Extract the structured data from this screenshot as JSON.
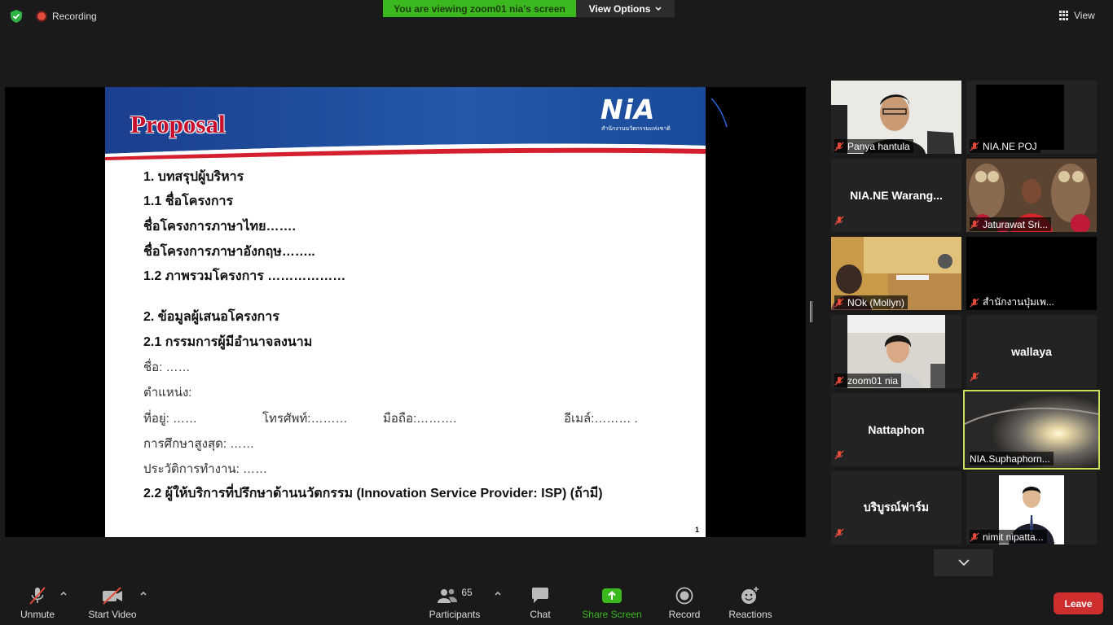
{
  "topbar": {
    "recording_label": "Recording",
    "viewing_banner": "You are viewing zoom01 nia's screen",
    "view_options_label": "View Options",
    "view_label": "View"
  },
  "slide": {
    "title": "Proposal",
    "logo_text": "NiA",
    "logo_subtext": "สำนักงานนวัตกรรมแห่งชาติ",
    "page_number": "1",
    "lines": {
      "l1": "1. บทสรุปผู้บริหาร",
      "l2": "1.1 ชื่อโครงการ",
      "l3": "ชื่อโครงการภาษาไทย…….",
      "l4": "ชื่อโครงการภาษาอังกฤษ……..",
      "l5": "1.2 ภาพรวมโครงการ ………………",
      "l6": "2. ข้อมูลผู้เสนอโครงการ",
      "l7": "2.1 กรรมการผู้มีอำนาจลงนาม",
      "l8": "ชื่อ: ……",
      "l9": "ตำแหน่ง:",
      "l10a": "ที่อยู่: ……",
      "l10b": "โทรศัพท์:………",
      "l10c": "มือถือ:……….",
      "l10d": "อีเมล์:……… .",
      "l11": "การศึกษาสูงสุด: ……",
      "l12": "ประวัติการทำงาน:  ……",
      "l13": "2.2 ผู้ให้บริการที่ปรึกษาด้านนวัตกรรม (Innovation Service Provider: ISP) (ถ้ามี)"
    }
  },
  "participants": [
    {
      "name": "Panya hantula"
    },
    {
      "name": "NIA.NE POJ"
    },
    {
      "name": "NIA.NE  Warang..."
    },
    {
      "name": "Jaturawat Sri..."
    },
    {
      "name": "NOk (Mollyn)"
    },
    {
      "name": "สำนักงานปุ่มเพ..."
    },
    {
      "name": "zoom01 nia"
    },
    {
      "name": "wallaya"
    },
    {
      "name": "Nattaphon"
    },
    {
      "name": "NIA.Suphaphorn..."
    },
    {
      "name": "บริบูรณ์ฟาร์ม"
    },
    {
      "name": "nimit nipatta..."
    }
  ],
  "toolbar": {
    "unmute": "Unmute",
    "start_video": "Start Video",
    "participants": "Participants",
    "participants_count": "65",
    "chat": "Chat",
    "share_screen": "Share Screen",
    "record": "Record",
    "reactions": "Reactions",
    "leave": "Leave"
  },
  "colors": {
    "share_green": "#3cb81f",
    "leave_red": "#cf2e2e",
    "active_speaker": "#cdde5c",
    "slide_title_red": "#c8102e",
    "slide_header_blue": "#1d3f8f"
  }
}
